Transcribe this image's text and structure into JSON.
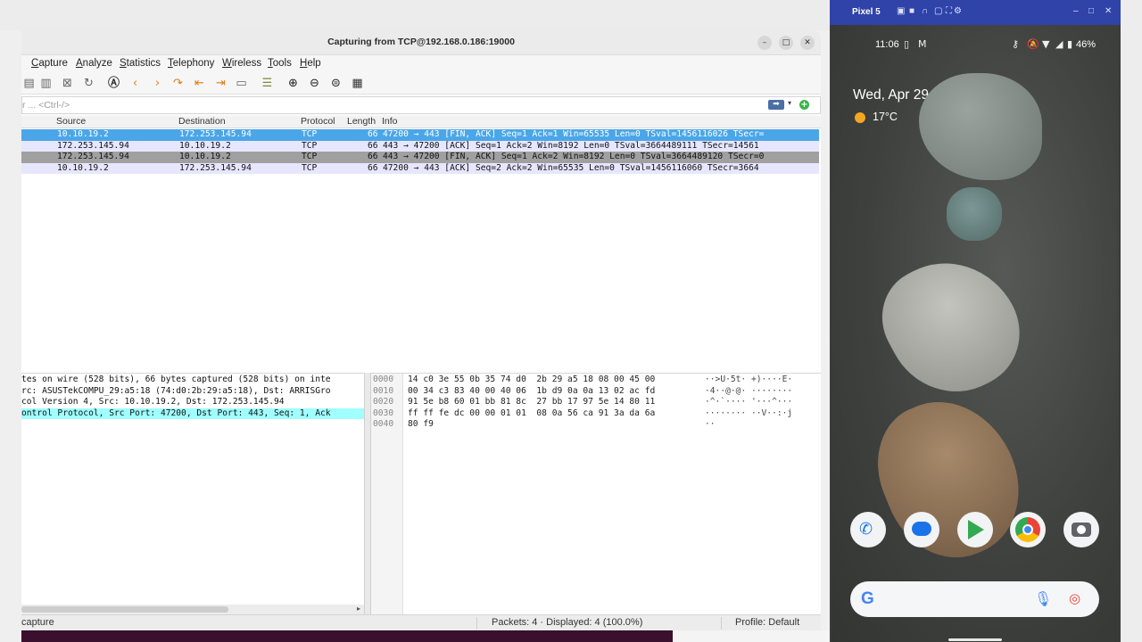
{
  "wireshark": {
    "title": "Capturing from TCP@192.168.0.186:19000",
    "window_controls": {
      "minimize": "–",
      "maximize": "□",
      "close": "✕"
    },
    "menu": [
      "Capture",
      "Analyze",
      "Statistics",
      "Telephony",
      "Wireless",
      "Tools",
      "Help"
    ],
    "filter": {
      "placeholder": "r ... <Ctrl-/>"
    },
    "columns": {
      "source": "Source",
      "destination": "Destination",
      "protocol": "Protocol",
      "length": "Length",
      "info": "Info"
    },
    "packets": [
      {
        "source": "10.10.19.2",
        "destination": "172.253.145.94",
        "protocol": "TCP",
        "length": "66",
        "info": "47200 → 443 [FIN, ACK] Seq=1 Ack=1 Win=65535 Len=0 TSval=1456116026 TSecr="
      },
      {
        "source": "172.253.145.94",
        "destination": "10.10.19.2",
        "protocol": "TCP",
        "length": "66",
        "info": "443 → 47200 [ACK] Seq=1 Ack=2 Win=8192 Len=0 TSval=3664489111 TSecr=14561"
      },
      {
        "source": "172.253.145.94",
        "destination": "10.10.19.2",
        "protocol": "TCP",
        "length": "66",
        "info": "443 → 47200 [FIN, ACK] Seq=1 Ack=2 Win=8192 Len=0 TSval=3664489120 TSecr=0"
      },
      {
        "source": "10.10.19.2",
        "destination": "172.253.145.94",
        "protocol": "TCP",
        "length": "66",
        "info": "47200 → 443 [ACK] Seq=2 Ack=2 Win=65535 Len=0 TSval=1456116060 TSecr=3664"
      }
    ],
    "details": [
      "tes on wire (528 bits), 66 bytes captured (528 bits) on inte",
      "rc: ASUSTekCOMPU_29:a5:18 (74:d0:2b:29:a5:18), Dst: ARRISGro",
      "col Version 4, Src: 10.10.19.2, Dst: 172.253.145.94",
      "ontrol Protocol, Src Port: 47200, Dst Port: 443, Seq: 1, Ack"
    ],
    "bytes": [
      {
        "offset": "0000",
        "hex": "14 c0 3e 55 0b 35 74 d0  2b 29 a5 18 08 00 45 00",
        "ascii": "··>U·5t· +)····E·"
      },
      {
        "offset": "0010",
        "hex": "00 34 c3 83 40 00 40 06  1b d9 0a 0a 13 02 ac fd",
        "ascii": "·4··@·@· ········"
      },
      {
        "offset": "0020",
        "hex": "91 5e b8 60 01 bb 81 8c  27 bb 17 97 5e 14 80 11",
        "ascii": "·^·`···· '···^···"
      },
      {
        "offset": "0030",
        "hex": "ff ff fe dc 00 00 01 01  08 0a 56 ca 91 3a da 6a",
        "ascii": "········ ··V··:·j"
      },
      {
        "offset": "0040",
        "hex": "80 f9",
        "ascii": "··"
      }
    ],
    "status": {
      "left": "capture",
      "packets": "Packets: 4 · Displayed: 4 (100.0%)",
      "profile": "Profile: Default"
    },
    "colors": {
      "selected_row": "#4aa6e8",
      "highlight_detail": "#a0ffff",
      "gray_row": "#a0a0a0",
      "lavender_row": "#e7e6ff"
    }
  },
  "emulator": {
    "device_name": "Pixel 5",
    "status_time": "11:06",
    "battery": "46%",
    "date": "Wed, Apr 29",
    "temperature": "17°C",
    "dock_apps": [
      "Phone",
      "Messages",
      "Play Store",
      "Chrome",
      "Camera"
    ],
    "colors": {
      "title_bar": "#2f43a8"
    }
  }
}
